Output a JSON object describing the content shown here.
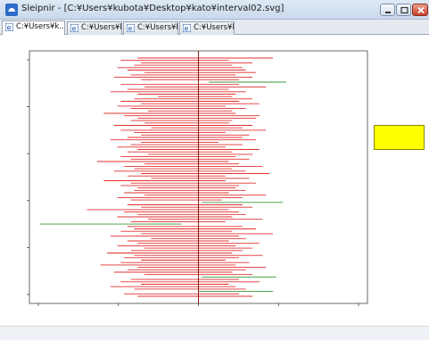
{
  "window": {
    "title": "Sleipnir - [C:¥Users¥kubota¥Desktop¥kato¥interval02.svg]"
  },
  "tabs": [
    {
      "label": "C:¥Users¥k..."
    },
    {
      "label": "C:¥Users¥k..."
    },
    {
      "label": "C:¥Users¥k..."
    },
    {
      "label": "C:¥Users¥k..."
    }
  ],
  "colors": {
    "covering": "#e03030",
    "missing": "#3a9a3a",
    "center": "#8b0000",
    "legend": "#ffff00"
  },
  "chart_data": {
    "type": "interval",
    "true_value": 0.5,
    "xlim": [
      0,
      1
    ],
    "grid": false,
    "legend": "right",
    "intervals": [
      [
        0.32,
        0.72,
        0
      ],
      [
        0.27,
        0.59,
        0
      ],
      [
        0.33,
        0.66,
        0
      ],
      [
        0.31,
        0.6,
        0
      ],
      [
        0.26,
        0.63,
        0
      ],
      [
        0.29,
        0.64,
        0
      ],
      [
        0.34,
        0.67,
        0
      ],
      [
        0.3,
        0.61,
        0
      ],
      [
        0.25,
        0.66,
        0
      ],
      [
        0.33,
        0.62,
        0
      ],
      [
        0.53,
        0.76,
        1
      ],
      [
        0.27,
        0.62,
        0
      ],
      [
        0.34,
        0.7,
        0
      ],
      [
        0.29,
        0.59,
        0
      ],
      [
        0.24,
        0.64,
        0
      ],
      [
        0.32,
        0.61,
        0
      ],
      [
        0.38,
        0.6,
        0
      ],
      [
        0.31,
        0.66,
        0
      ],
      [
        0.27,
        0.62,
        0
      ],
      [
        0.33,
        0.68,
        0
      ],
      [
        0.26,
        0.58,
        0
      ],
      [
        0.3,
        0.64,
        0
      ],
      [
        0.35,
        0.6,
        0
      ],
      [
        0.22,
        0.61,
        0
      ],
      [
        0.28,
        0.68,
        0
      ],
      [
        0.32,
        0.67,
        0
      ],
      [
        0.3,
        0.6,
        0
      ],
      [
        0.34,
        0.59,
        0
      ],
      [
        0.25,
        0.66,
        0
      ],
      [
        0.36,
        0.63,
        0
      ],
      [
        0.27,
        0.7,
        0
      ],
      [
        0.31,
        0.58,
        0
      ],
      [
        0.33,
        0.65,
        0
      ],
      [
        0.29,
        0.63,
        0
      ],
      [
        0.24,
        0.67,
        0
      ],
      [
        0.33,
        0.56,
        0
      ],
      [
        0.3,
        0.63,
        0
      ],
      [
        0.26,
        0.58,
        0
      ],
      [
        0.32,
        0.68,
        0
      ],
      [
        0.29,
        0.6,
        0
      ],
      [
        0.35,
        0.66,
        0
      ],
      [
        0.27,
        0.61,
        0
      ],
      [
        0.3,
        0.65,
        0
      ],
      [
        0.2,
        0.59,
        0
      ],
      [
        0.34,
        0.62,
        0
      ],
      [
        0.28,
        0.69,
        0
      ],
      [
        0.31,
        0.6,
        0
      ],
      [
        0.25,
        0.64,
        0
      ],
      [
        0.33,
        0.71,
        0
      ],
      [
        0.29,
        0.58,
        0
      ],
      [
        0.36,
        0.65,
        0
      ],
      [
        0.22,
        0.58,
        0
      ],
      [
        0.3,
        0.67,
        0
      ],
      [
        0.27,
        0.62,
        0
      ],
      [
        0.32,
        0.61,
        0
      ],
      [
        0.31,
        0.64,
        0
      ],
      [
        0.28,
        0.59,
        0
      ],
      [
        0.34,
        0.7,
        0
      ],
      [
        0.26,
        0.63,
        0
      ],
      [
        0.3,
        0.57,
        0
      ],
      [
        0.51,
        0.75,
        1
      ],
      [
        0.29,
        0.63,
        0
      ],
      [
        0.33,
        0.66,
        0
      ],
      [
        0.17,
        0.59,
        0
      ],
      [
        0.28,
        0.62,
        0
      ],
      [
        0.32,
        0.64,
        0
      ],
      [
        0.26,
        0.6,
        0
      ],
      [
        0.35,
        0.69,
        0
      ],
      [
        0.3,
        0.58,
        0
      ],
      [
        0.03,
        0.45,
        1
      ],
      [
        0.29,
        0.63,
        0
      ],
      [
        0.31,
        0.67,
        0
      ],
      [
        0.27,
        0.6,
        0
      ],
      [
        0.33,
        0.72,
        0
      ],
      [
        0.24,
        0.62,
        0
      ],
      [
        0.36,
        0.64,
        0
      ],
      [
        0.29,
        0.59,
        0
      ],
      [
        0.32,
        0.68,
        0
      ],
      [
        0.26,
        0.61,
        0
      ],
      [
        0.34,
        0.66,
        0
      ],
      [
        0.3,
        0.63,
        0
      ],
      [
        0.23,
        0.6,
        0
      ],
      [
        0.31,
        0.69,
        0
      ],
      [
        0.28,
        0.62,
        0
      ],
      [
        0.33,
        0.58,
        0
      ],
      [
        0.27,
        0.65,
        0
      ],
      [
        0.21,
        0.61,
        0
      ],
      [
        0.32,
        0.7,
        0
      ],
      [
        0.29,
        0.64,
        0
      ],
      [
        0.25,
        0.6,
        0
      ],
      [
        0.34,
        0.66,
        0
      ],
      [
        0.51,
        0.73,
        1
      ],
      [
        0.3,
        0.62,
        0
      ],
      [
        0.27,
        0.68,
        0
      ],
      [
        0.33,
        0.59,
        0
      ],
      [
        0.24,
        0.61,
        0
      ],
      [
        0.31,
        0.64,
        0
      ],
      [
        0.5,
        0.72,
        1
      ],
      [
        0.28,
        0.62,
        0
      ],
      [
        0.32,
        0.66,
        0
      ]
    ]
  }
}
